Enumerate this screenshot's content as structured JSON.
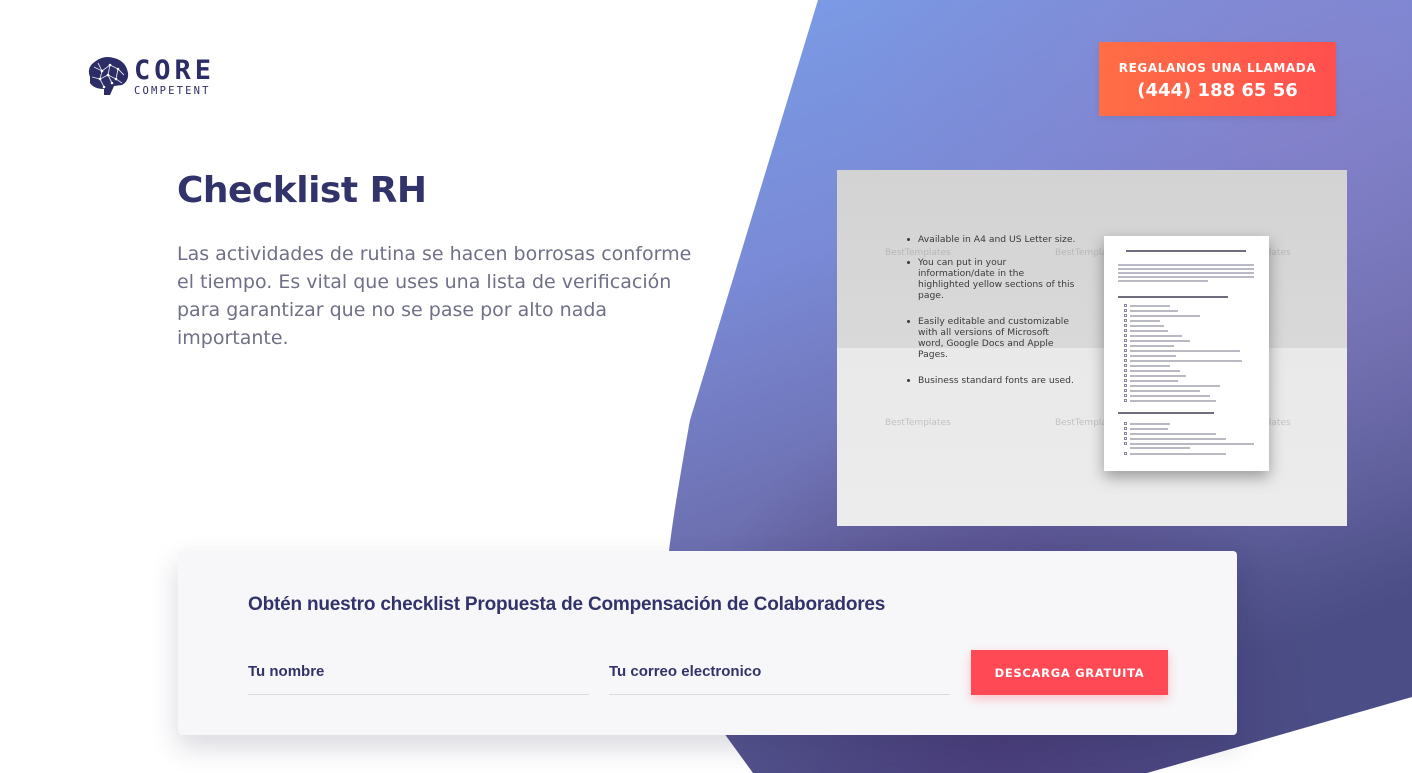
{
  "brand": {
    "name": "CORE",
    "tagline": "COMPETENT",
    "logo_icon": "brain-icon",
    "primary_color": "#33336b",
    "accent_color": "#ff4a55"
  },
  "header": {
    "call_label": "REGALANOS UNA LLAMADA",
    "call_phone": "(444) 188 65 56"
  },
  "hero": {
    "title": "Checklist RH",
    "description": "Las actividades de rutina se hacen borrosas conforme el tiempo. Es vital que uses una lista de verificación para garantizar que no se pase por alto nada importante."
  },
  "preview": {
    "bullets": [
      "Available in A4 and US Letter size.",
      "You can put in your information/date in the highlighted yellow sections of this page.",
      "Easily editable and customizable with all versions of Microsoft word, Google Docs and Apple Pages.",
      "Business standard fonts are used."
    ],
    "watermark": "BestTemplates"
  },
  "form": {
    "title": "Obtén nuestro checklist Propuesta de Compensación de Colaboradores",
    "name_placeholder": "Tu nombre",
    "email_placeholder": "Tu correo electronico",
    "submit_label": "DESCARGA GRATUITA"
  }
}
